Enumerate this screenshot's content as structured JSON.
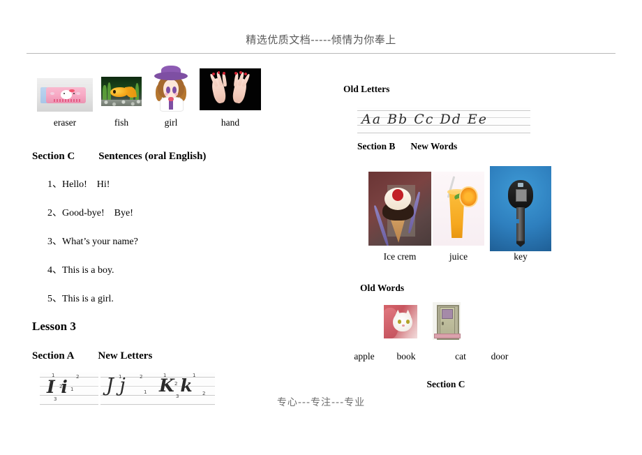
{
  "document": {
    "header_text": "精选优质文档-----倾情为你奉上",
    "footer_text": "专心---专注---专业"
  },
  "left_column": {
    "word_pictures": [
      {
        "label": "eraser",
        "image_name": "eraser-picture"
      },
      {
        "label": "fish",
        "image_name": "fish-picture"
      },
      {
        "label": "girl",
        "image_name": "girl-picture"
      },
      {
        "label": "hand",
        "image_name": "hand-picture"
      }
    ],
    "section_c": {
      "section_label": "Section C",
      "section_title": "Sentences (oral English)",
      "sentences": [
        {
          "num": "1、",
          "text": "Hello!    Hi!"
        },
        {
          "num": "2、",
          "text": "Good-bye!    Bye!"
        },
        {
          "num": "3、",
          "text": "What’s your name?"
        },
        {
          "num": "4、",
          "text": "This is a boy."
        },
        {
          "num": "5、",
          "text": "This is a girl."
        }
      ]
    },
    "lesson": {
      "title": "Lesson 3"
    },
    "section_a": {
      "section_label": "Section A",
      "section_title": "New Letters",
      "handwriting": [
        {
          "glyphs": "I i",
          "strokes": [
            "1",
            "2",
            "3",
            "2",
            "1"
          ]
        },
        {
          "glyphs": "J j",
          "strokes": [
            "1",
            "2",
            "1"
          ]
        },
        {
          "glyphs": "K k",
          "strokes": [
            "1",
            "2",
            "3",
            "1",
            "2"
          ]
        }
      ]
    }
  },
  "right_column": {
    "old_letters": {
      "title": "Old Letters",
      "handwriting_glyphs": "Aa  Bb   Cc   Dd   Ee"
    },
    "section_b": {
      "section_label": "Section B",
      "section_title": "New Words",
      "word_pictures": [
        {
          "label": "Ice crem",
          "image_name": "ice-cream-picture"
        },
        {
          "label": "juice",
          "image_name": "juice-picture"
        },
        {
          "label": "key",
          "image_name": "key-picture"
        }
      ]
    },
    "old_words": {
      "title": "Old Words",
      "labels": [
        "apple",
        "book",
        "cat",
        "door"
      ],
      "pictures": [
        {
          "image_name": "cat-picture"
        },
        {
          "image_name": "door-picture"
        }
      ]
    },
    "section_c": {
      "section_label": "Section C"
    }
  }
}
